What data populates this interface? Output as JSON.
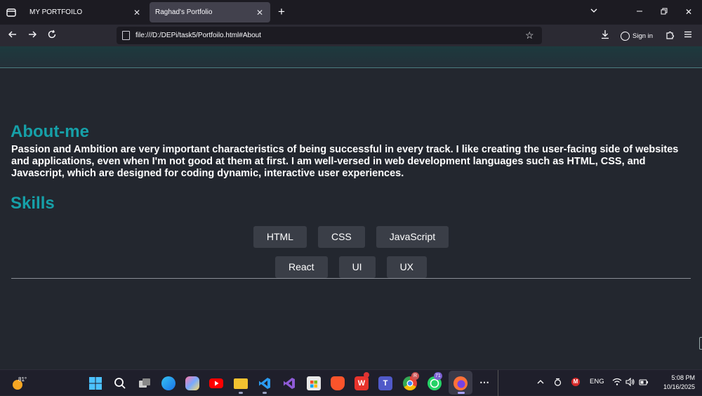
{
  "browser": {
    "tabs": [
      {
        "title": "MY PORTFOILO",
        "active": false
      },
      {
        "title": "Raghad's Portfolio",
        "active": true
      }
    ],
    "url": "file:///D:/DEPi/task5/Portfoilo.html#About",
    "signin_label": "Sign in"
  },
  "page": {
    "about": {
      "heading": "About-me",
      "text": "Passion and Ambition are very important characteristics of being successful in every track. I like creating the user-facing side of websites and applications, even when I'm not good at them at first. I am well-versed in web development languages such as HTML, CSS, and Javascript, which are designed for coding dynamic, interactive user experiences."
    },
    "skills": {
      "heading": "Skills",
      "row1": [
        "HTML",
        "CSS",
        "JavaScript"
      ],
      "row2": [
        "React",
        "UI",
        "UX"
      ]
    },
    "colors": {
      "accent": "#16a0a8",
      "background": "#23272f",
      "skill_bg": "#3a3e47"
    }
  },
  "taskbar": {
    "weather_temp": "81°",
    "edge_badge": "",
    "chrome_badge": "R",
    "whatsapp_badge": "71",
    "language": "ENG",
    "time": "5:08 PM",
    "date": "10/16/2025",
    "icons": [
      "windows-start",
      "search",
      "task-view",
      "edge",
      "copilot",
      "youtube",
      "file-explorer",
      "vs-code",
      "visual-studio",
      "store",
      "brave",
      "wps",
      "teams",
      "chrome",
      "whatsapp",
      "firefox",
      "more"
    ]
  }
}
